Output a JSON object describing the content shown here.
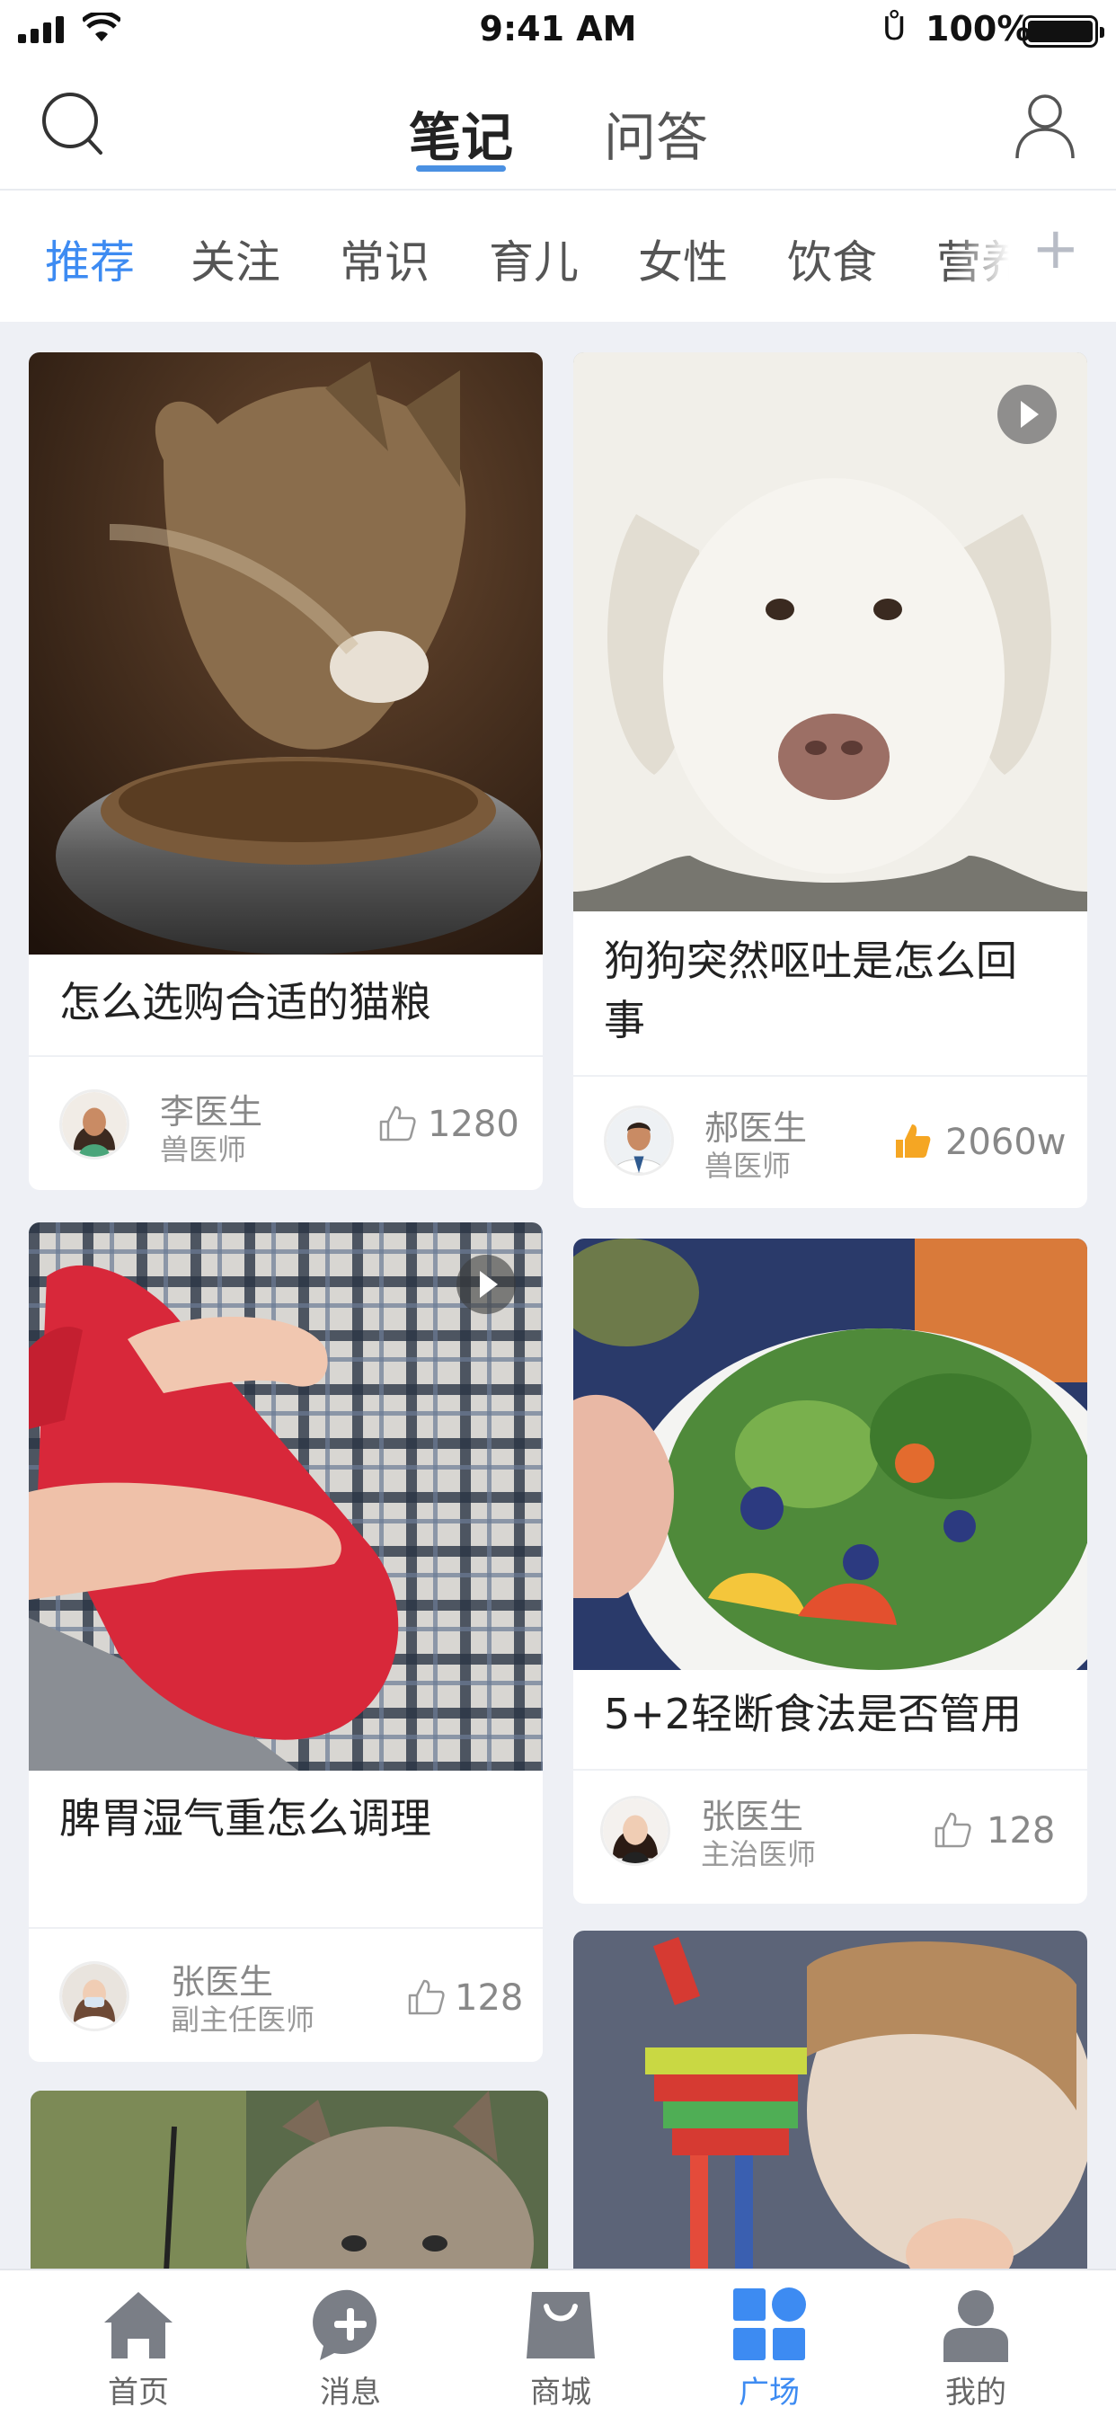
{
  "status_bar": {
    "time": "9:41 AM",
    "battery": "100%"
  },
  "header": {
    "tabs": [
      {
        "label": "笔记",
        "active": true
      },
      {
        "label": "问答",
        "active": false
      }
    ],
    "search_icon": "search-icon",
    "profile_icon": "user-icon"
  },
  "categories": [
    "推荐",
    "关注",
    "常识",
    "育儿",
    "女性",
    "饮食",
    "营养"
  ],
  "categories_active": "推荐",
  "cards": [
    {
      "title": "怎么选购合适的猫粮",
      "author": "李医生",
      "role": "兽医师",
      "likes": "1280",
      "liked": false,
      "video": false
    },
    {
      "title_line1": "狗狗突然呕吐是怎么回",
      "title_line2": "事",
      "author": "郝医生",
      "role": "兽医师",
      "likes": "2060w",
      "liked": true,
      "video": true
    },
    {
      "title": "脾胃湿气重怎么调理",
      "author": "张医生",
      "role": "副主任医师",
      "likes": "128",
      "liked": false,
      "video": true
    },
    {
      "title": "5+2轻断食法是否管用",
      "author": "张医生",
      "role": "主治医师",
      "likes": "128",
      "liked": false,
      "video": false
    }
  ],
  "tabbar": [
    {
      "label": "首页",
      "icon": "home-icon"
    },
    {
      "label": "消息",
      "icon": "message-plus-icon"
    },
    {
      "label": "商城",
      "icon": "shopping-bag-icon"
    },
    {
      "label": "广场",
      "icon": "square-grid-icon",
      "active": true
    },
    {
      "label": "我的",
      "icon": "profile-icon"
    }
  ],
  "colors": {
    "accent": "#3d8bf2",
    "like_active": "#f5a623",
    "background": "#eef0f5"
  }
}
